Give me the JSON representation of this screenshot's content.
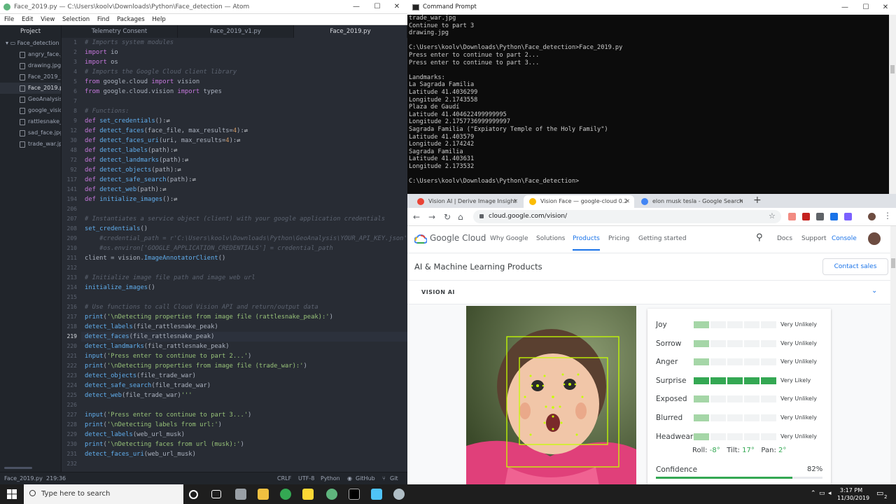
{
  "atom": {
    "title": "Face_2019.py — C:\\Users\\koolv\\Downloads\\Python\\Face_detection — Atom",
    "menu": [
      "File",
      "Edit",
      "View",
      "Selection",
      "Find",
      "Packages",
      "Help"
    ],
    "tabs": [
      "Project",
      "Telemetry Consent",
      "Face_2019_v1.py",
      "Face_2019.py"
    ],
    "tree": {
      "folder": "Face_detection",
      "files": [
        "angry_face.jp",
        "drawing.jpg",
        "Face_2019_v1",
        "Face_2019.py",
        "GeoAnalysis-",
        "google_vision",
        "rattlesnake_p",
        "sad_face.jpg",
        "trade_war.jpg"
      ]
    },
    "line_numbers": [
      "1",
      "2",
      "3",
      "4",
      "5",
      "6",
      "7",
      "8",
      "9",
      "12",
      "30",
      "48",
      "72",
      "92",
      "117",
      "141",
      "194",
      "206",
      "207",
      "208",
      "209",
      "210",
      "211",
      "212",
      "213",
      "214",
      "215",
      "216",
      "217",
      "218",
      "219",
      "220",
      "221",
      "222",
      "223",
      "224",
      "225",
      "226",
      "227",
      "228",
      "229",
      "230",
      "231",
      "232"
    ],
    "status": {
      "file": "Face_2019.py",
      "position": "219:36",
      "line_ending": "CRLF",
      "encoding": "UTF-8",
      "grammar": "Python",
      "github": "GitHub",
      "git": "Git (0)"
    }
  },
  "cmd": {
    "title": "Command Prompt",
    "lines": [
      "trade_war.jpg",
      "Continue to part 3",
      "drawing.jpg",
      "",
      "C:\\Users\\koolv\\Downloads\\Python\\Face_detection>Face_2019.py",
      "Press enter to continue to part 2...",
      "Press enter to continue to part 3...",
      "",
      "Landmarks:",
      "La Sagrada Familia",
      "Latitude 41.4036299",
      "Longitude 2.1743558",
      "Plaza de Gaudí",
      "Latitude 41.404622499999995",
      "Longitude 2.1757736999999997",
      "Sagrada Familia (\"Expiatory Temple of the Holy Family\")",
      "Latitude 41.403579",
      "Longitude 2.174242",
      "Sagrada Familia",
      "Latitude 41.403631",
      "Longitude 2.173532",
      "",
      "C:\\Users\\koolv\\Downloads\\Python\\Face_detection>"
    ]
  },
  "chrome": {
    "tabs": [
      "Vision AI | Derive Image Insight",
      "Vision Face — google-cloud 0.2",
      "elon musk tesla - Google Search"
    ],
    "url": "cloud.google.com/vision/",
    "page": {
      "brand": "Google Cloud",
      "nav": [
        "Why Google",
        "Solutions",
        "Products",
        "Pricing",
        "Getting started"
      ],
      "right_links": [
        "Docs",
        "Support",
        "Console"
      ],
      "section_title": "AI & Machine Learning Products",
      "contact_button": "Contact sales",
      "vision_heading": "VISION AI",
      "emotions": [
        {
          "label": "Joy",
          "likelihood": "Very Unlikely",
          "level": 1
        },
        {
          "label": "Sorrow",
          "likelihood": "Very Unlikely",
          "level": 1
        },
        {
          "label": "Anger",
          "likelihood": "Very Unlikely",
          "level": 1
        },
        {
          "label": "Surprise",
          "likelihood": "Very Likely",
          "level": 5
        },
        {
          "label": "Exposed",
          "likelihood": "Very Unlikely",
          "level": 1
        },
        {
          "label": "Blurred",
          "likelihood": "Very Unlikely",
          "level": 1
        },
        {
          "label": "Headwear",
          "likelihood": "Very Unlikely",
          "level": 1
        }
      ],
      "angles": {
        "roll_label": "Roll:",
        "roll": "-8°",
        "tilt_label": "Tilt:",
        "tilt": "17°",
        "pan_label": "Pan:",
        "pan": "2°"
      },
      "confidence_label": "Confidence",
      "confidence": "82%",
      "confidence_value": 0.82
    }
  },
  "taskbar": {
    "search_placeholder": "Type here to search",
    "time": "3:17 PM",
    "date": "11/30/2019",
    "notifications": "2"
  }
}
